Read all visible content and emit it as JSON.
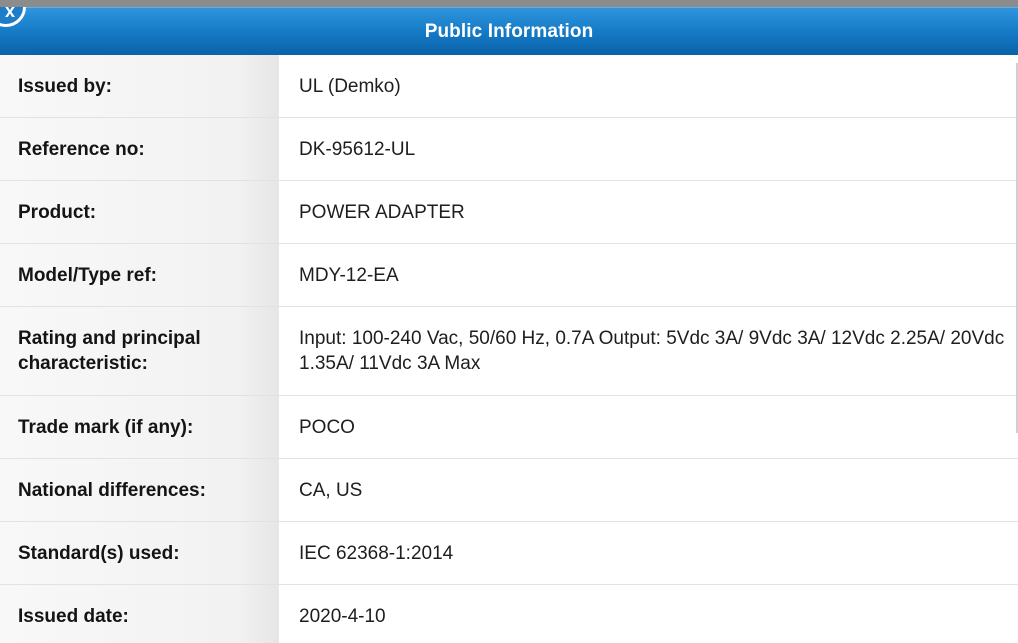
{
  "dialog": {
    "title": "Public Information",
    "close_glyph": "x"
  },
  "rows": [
    {
      "label": "Issued by:",
      "value": "UL (Demko)"
    },
    {
      "label": "Reference no:",
      "value": "DK-95612-UL"
    },
    {
      "label": "Product:",
      "value": "POWER ADAPTER"
    },
    {
      "label": "Model/Type ref:",
      "value": "MDY-12-EA"
    },
    {
      "label": "Rating and principal characteristic:",
      "value": "Input: 100-240 Vac, 50/60 Hz, 0.7A Output: 5Vdc 3A/ 9Vdc 3A/ 12Vdc 2.25A/ 20Vdc 1.35A/ 11Vdc 3A Max"
    },
    {
      "label": "Trade mark (if any):",
      "value": "POCO"
    },
    {
      "label": "National differences:",
      "value": "CA, US"
    },
    {
      "label": "Standard(s) used:",
      "value": "IEC 62368-1:2014"
    },
    {
      "label": "Issued date:",
      "value": "2020-4-10"
    }
  ],
  "colors": {
    "header_top": "#2f95dd",
    "header_bottom": "#0a63a8",
    "label_bg": "#f2f2f2",
    "backdrop": "#8c8c8c"
  }
}
